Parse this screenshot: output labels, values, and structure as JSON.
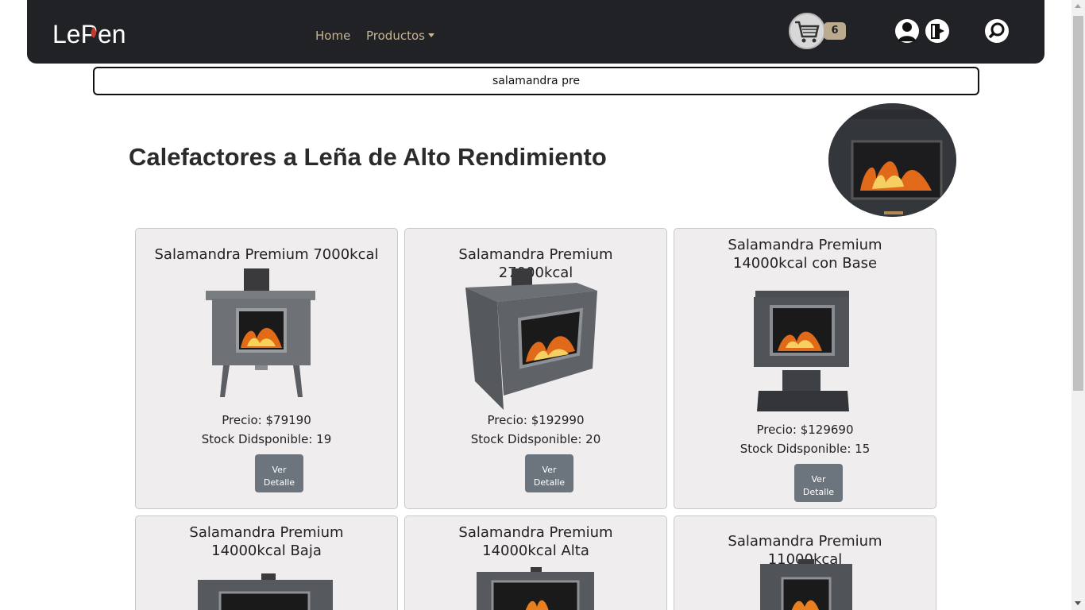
{
  "brand": {
    "logo_text": "LePen"
  },
  "nav": {
    "home": "Home",
    "products": "Productos",
    "cart_count": "6",
    "icons": [
      "cart-icon",
      "user-icon",
      "logout-icon",
      "search-icon"
    ]
  },
  "search": {
    "value": "salamandra pre"
  },
  "page": {
    "title": "Calefactores a Leña de Alto Rendimiento"
  },
  "products": [
    {
      "name": "Salamandra Premium 7000kcal",
      "price": "Precio: $79190",
      "stock": "Stock Didsponible: 19",
      "btn_line1": "Ver",
      "btn_line2": "Detalle"
    },
    {
      "name": "Salamandra Premium 27000kcal",
      "price": "Precio: $192990",
      "stock": "Stock Didsponible: 20",
      "btn_line1": "Ver",
      "btn_line2": "Detalle"
    },
    {
      "name": "Salamandra Premium 14000kcal con Base",
      "price": "Precio: $129690",
      "stock": "Stock Didsponible: 15",
      "btn_line1": "Ver",
      "btn_line2": "Detalle"
    },
    {
      "name": "Salamandra Premium 14000kcal Baja"
    },
    {
      "name": "Salamandra Premium 14000kcal Alta"
    },
    {
      "name": "Salamandra Premium 11000kcal"
    }
  ],
  "colors": {
    "navbar": "#212226",
    "nav_link": "#c9b591",
    "badge": "#bcaa8e",
    "button": "#6c757d",
    "card_bg": "#efedee"
  }
}
